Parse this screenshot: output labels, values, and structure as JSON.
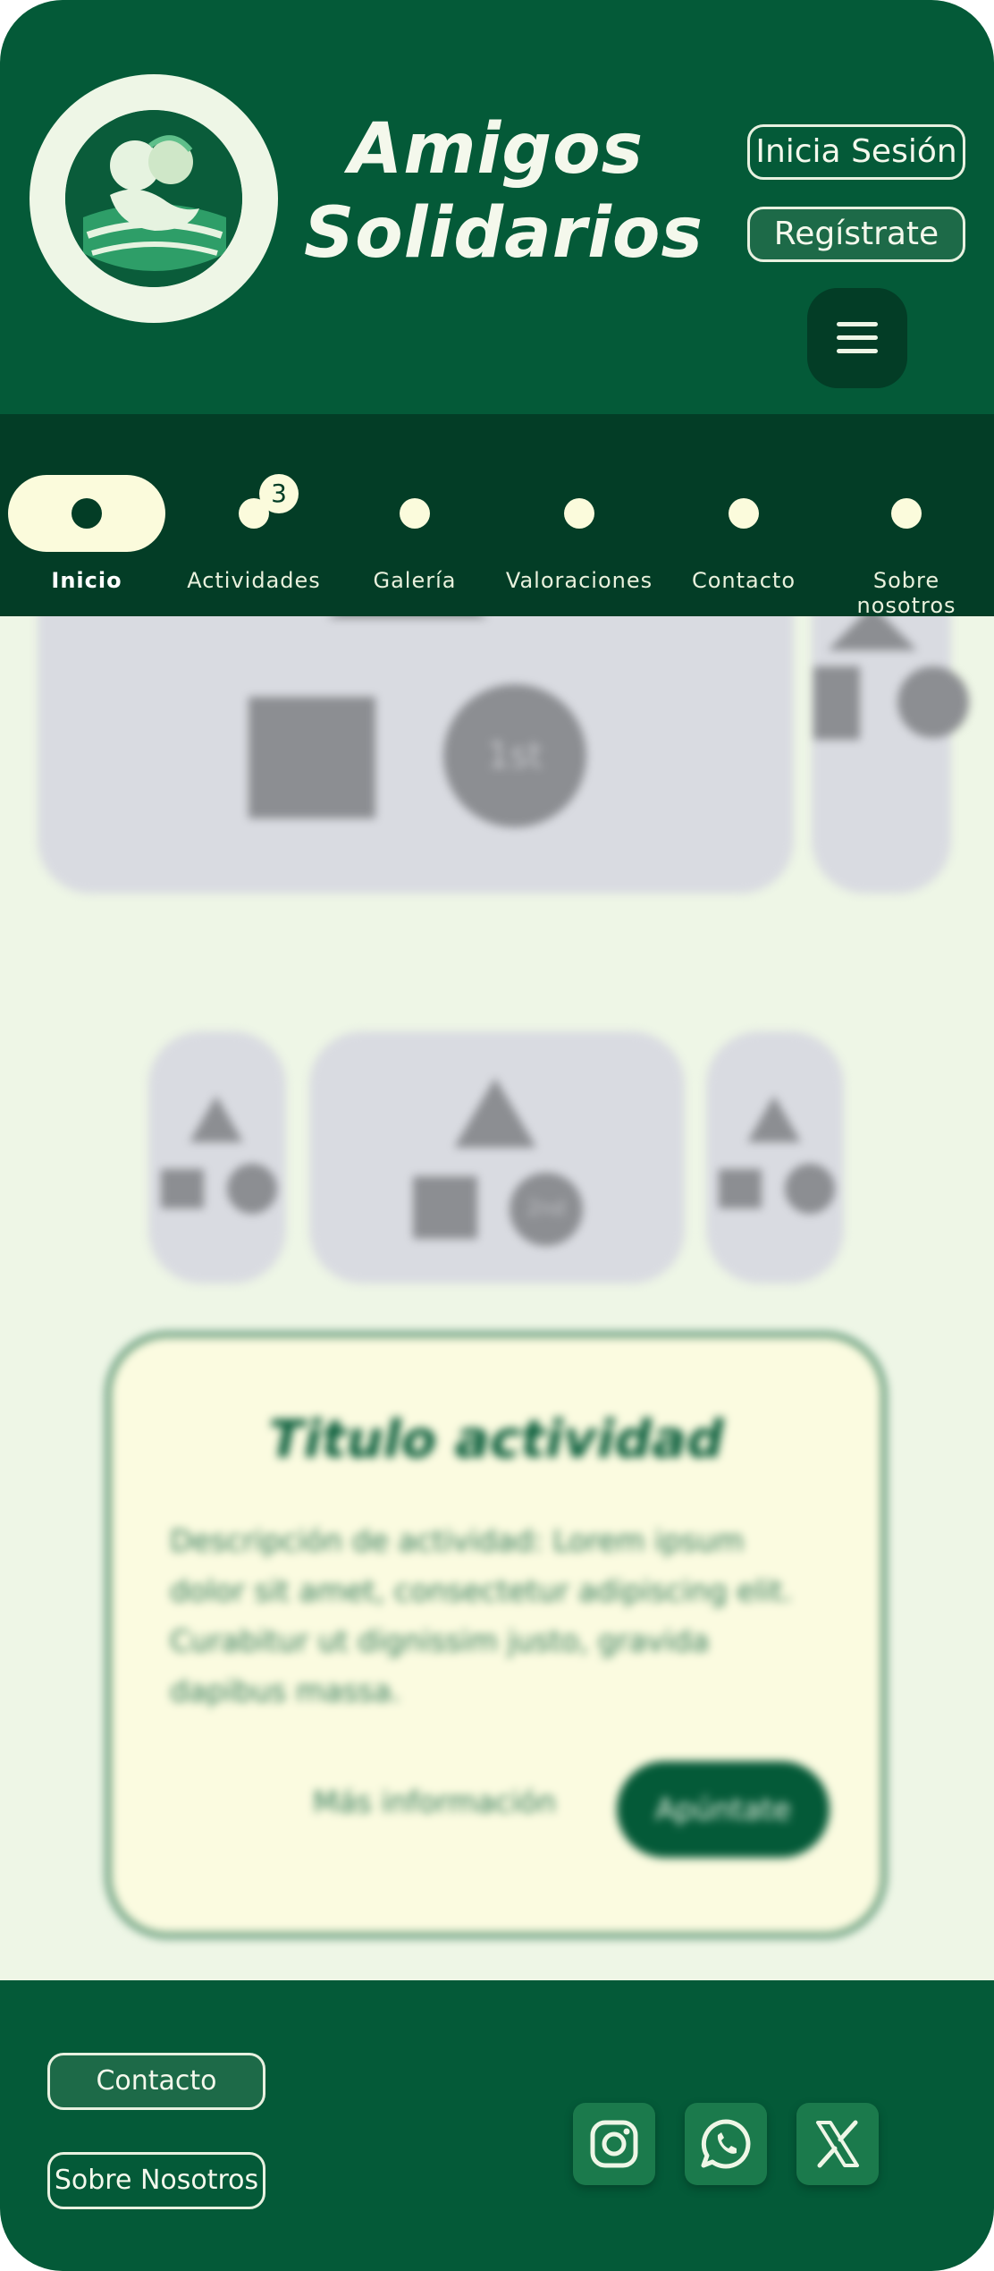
{
  "header": {
    "brand_line1": "Amigos",
    "brand_line2": "Solidarios",
    "login_label": "Inicia Sesión",
    "register_label": "Regístrate",
    "logo_icon": "hugging-friends-logo",
    "menu_icon": "hamburger-menu-icon"
  },
  "nav": {
    "items": [
      {
        "label": "Inicio",
        "active": true
      },
      {
        "label": "Actividades",
        "badge": "3"
      },
      {
        "label": "Galería"
      },
      {
        "label": "Valoraciones"
      },
      {
        "label": "Contacto"
      },
      {
        "label": "Sobre nosotros"
      }
    ]
  },
  "content": {
    "placeholder_top_badge": "1st",
    "placeholder_mid_badge": "2nd",
    "activity": {
      "title": "Titulo actividad",
      "description": "Descripción de actividad: Lorem ipsum dolor sit amet, consectetur adipiscing elit. Curabitur ut dignissim justo, gravida dapibus massa.",
      "more_label": "Más información",
      "join_label": "Apúntate"
    }
  },
  "footer": {
    "contact_label": "Contacto",
    "about_label": "Sobre Nosotros",
    "social_icons": [
      "instagram-icon",
      "whatsapp-icon",
      "x-icon"
    ]
  },
  "colors": {
    "primary": "#045a38",
    "nav_bg": "#033d26",
    "cream": "#fbfbdc",
    "background": "#eef6e6"
  }
}
